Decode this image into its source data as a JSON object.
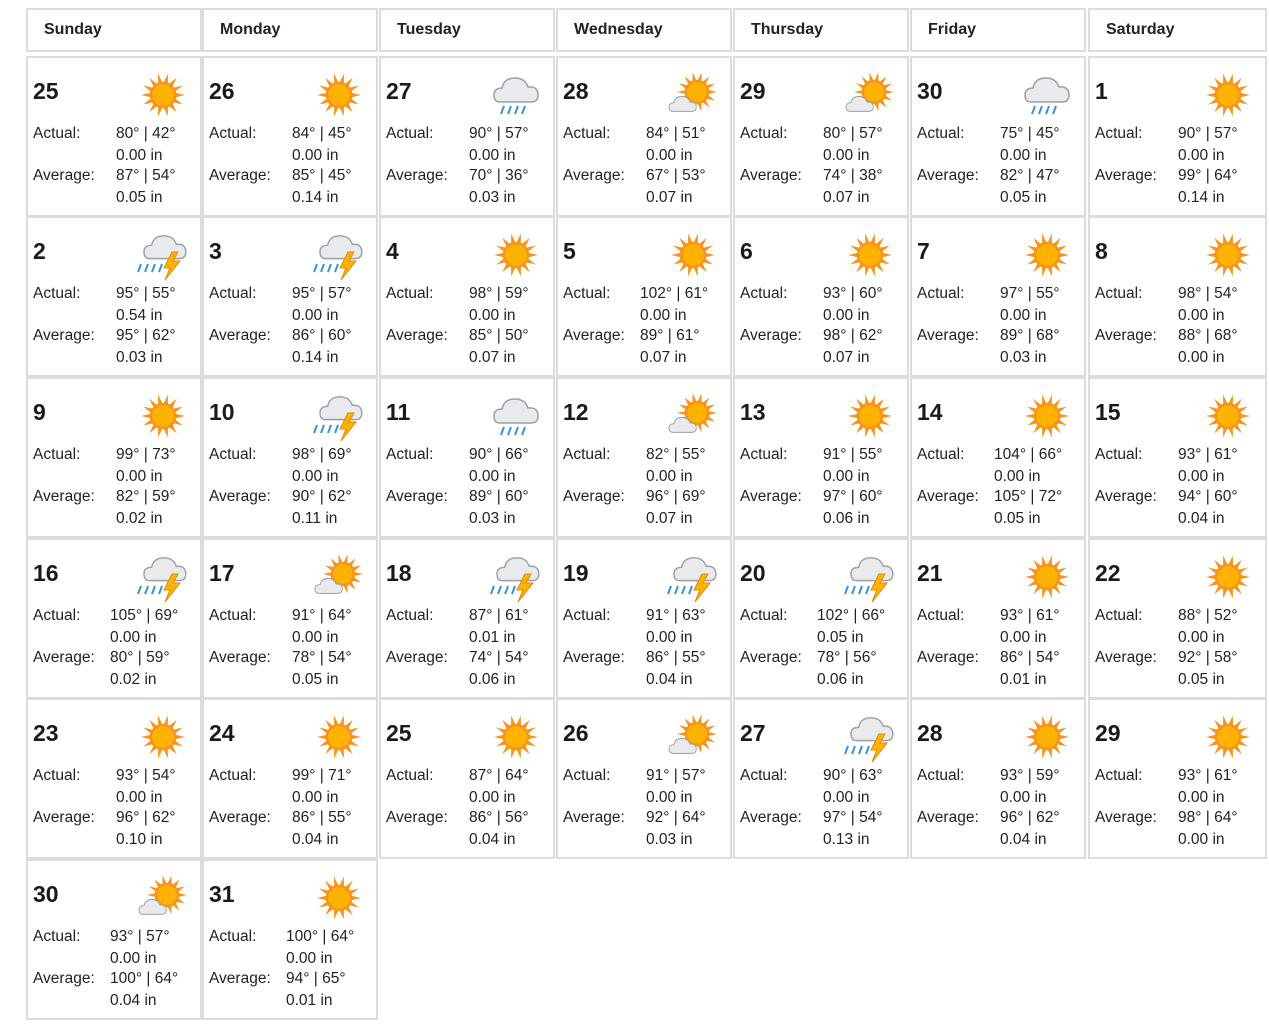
{
  "calendar": {
    "weekdays": [
      "Sunday",
      "Monday",
      "Tuesday",
      "Wednesday",
      "Thursday",
      "Friday",
      "Saturday"
    ],
    "actual_label": "Actual:",
    "average_label": "Average:",
    "colors": {
      "sun": "#f7941d",
      "sun_core": "#ffb300",
      "cloud": "#cfd3d6",
      "rain": "#3b8fd6",
      "bolt": "#ffb300",
      "border": "#dcdcdc"
    },
    "days": [
      {
        "day": "25",
        "icon": "sunny-icon",
        "actual_temp": "80° | 42°",
        "actual_precip": "0.00 in",
        "average_temp": "87° | 54°",
        "average_precip": "0.05 in"
      },
      {
        "day": "26",
        "icon": "sunny-icon",
        "actual_temp": "84° | 45°",
        "actual_precip": "0.00 in",
        "average_temp": "85° | 45°",
        "average_precip": "0.14 in"
      },
      {
        "day": "27",
        "icon": "rain-icon",
        "actual_temp": "90° | 57°",
        "actual_precip": "0.00 in",
        "average_temp": "70° | 36°",
        "average_precip": "0.03 in"
      },
      {
        "day": "28",
        "icon": "partly-cloudy-icon",
        "actual_temp": "84° | 51°",
        "actual_precip": "0.00 in",
        "average_temp": "67° | 53°",
        "average_precip": "0.07 in"
      },
      {
        "day": "29",
        "icon": "partly-cloudy-icon",
        "actual_temp": "80° | 57°",
        "actual_precip": "0.00 in",
        "average_temp": "74° | 38°",
        "average_precip": "0.07 in"
      },
      {
        "day": "30",
        "icon": "rain-icon",
        "actual_temp": "75° | 45°",
        "actual_precip": "0.00 in",
        "average_temp": "82° | 47°",
        "average_precip": "0.05 in"
      },
      {
        "day": "1",
        "icon": "sunny-icon",
        "actual_temp": "90° | 57°",
        "actual_precip": "0.00 in",
        "average_temp": "99° | 64°",
        "average_precip": "0.14 in"
      },
      {
        "day": "2",
        "icon": "thunderstorm-icon",
        "actual_temp": "95° | 55°",
        "actual_precip": "0.54 in",
        "average_temp": "95° | 62°",
        "average_precip": "0.03 in"
      },
      {
        "day": "3",
        "icon": "thunderstorm-icon",
        "actual_temp": "95° | 57°",
        "actual_precip": "0.00 in",
        "average_temp": "86° | 60°",
        "average_precip": "0.14 in"
      },
      {
        "day": "4",
        "icon": "sunny-icon",
        "actual_temp": "98° | 59°",
        "actual_precip": "0.00 in",
        "average_temp": "85° | 50°",
        "average_precip": "0.07 in"
      },
      {
        "day": "5",
        "icon": "sunny-icon",
        "actual_temp": "102° | 61°",
        "actual_precip": "0.00 in",
        "average_temp": "89° | 61°",
        "average_precip": "0.07 in"
      },
      {
        "day": "6",
        "icon": "sunny-icon",
        "actual_temp": "93° | 60°",
        "actual_precip": "0.00 in",
        "average_temp": "98° | 62°",
        "average_precip": "0.07 in"
      },
      {
        "day": "7",
        "icon": "sunny-icon",
        "actual_temp": "97° | 55°",
        "actual_precip": "0.00 in",
        "average_temp": "89° | 68°",
        "average_precip": "0.03 in"
      },
      {
        "day": "8",
        "icon": "sunny-icon",
        "actual_temp": "98° | 54°",
        "actual_precip": "0.00 in",
        "average_temp": "88° | 68°",
        "average_precip": "0.00 in"
      },
      {
        "day": "9",
        "icon": "sunny-icon",
        "actual_temp": "99° | 73°",
        "actual_precip": "0.00 in",
        "average_temp": "82° | 59°",
        "average_precip": "0.02 in"
      },
      {
        "day": "10",
        "icon": "thunderstorm-icon",
        "actual_temp": "98° | 69°",
        "actual_precip": "0.00 in",
        "average_temp": "90° | 62°",
        "average_precip": "0.11 in"
      },
      {
        "day": "11",
        "icon": "rain-icon",
        "actual_temp": "90° | 66°",
        "actual_precip": "0.00 in",
        "average_temp": "89° | 60°",
        "average_precip": "0.03 in"
      },
      {
        "day": "12",
        "icon": "partly-cloudy-icon",
        "actual_temp": "82° | 55°",
        "actual_precip": "0.00 in",
        "average_temp": "96° | 69°",
        "average_precip": "0.07 in"
      },
      {
        "day": "13",
        "icon": "sunny-icon",
        "actual_temp": "91° | 55°",
        "actual_precip": "0.00 in",
        "average_temp": "97° | 60°",
        "average_precip": "0.06 in"
      },
      {
        "day": "14",
        "icon": "sunny-icon",
        "actual_temp": "104° | 66°",
        "actual_precip": "0.00 in",
        "average_temp": "105° | 72°",
        "average_precip": "0.05 in"
      },
      {
        "day": "15",
        "icon": "sunny-icon",
        "actual_temp": "93° | 61°",
        "actual_precip": "0.00 in",
        "average_temp": "94° | 60°",
        "average_precip": "0.04 in"
      },
      {
        "day": "16",
        "icon": "thunderstorm-icon",
        "actual_temp": "105° | 69°",
        "actual_precip": "0.00 in",
        "average_temp": "80° | 59°",
        "average_precip": "0.02 in"
      },
      {
        "day": "17",
        "icon": "partly-cloudy-icon",
        "actual_temp": "91° | 64°",
        "actual_precip": "0.00 in",
        "average_temp": "78° | 54°",
        "average_precip": "0.05 in"
      },
      {
        "day": "18",
        "icon": "thunderstorm-icon",
        "actual_temp": "87° | 61°",
        "actual_precip": "0.01 in",
        "average_temp": "74° | 54°",
        "average_precip": "0.06 in"
      },
      {
        "day": "19",
        "icon": "thunderstorm-icon",
        "actual_temp": "91° | 63°",
        "actual_precip": "0.00 in",
        "average_temp": "86° | 55°",
        "average_precip": "0.04 in"
      },
      {
        "day": "20",
        "icon": "thunderstorm-icon",
        "actual_temp": "102° | 66°",
        "actual_precip": "0.05 in",
        "average_temp": "78° | 56°",
        "average_precip": "0.06 in"
      },
      {
        "day": "21",
        "icon": "sunny-icon",
        "actual_temp": "93° | 61°",
        "actual_precip": "0.00 in",
        "average_temp": "86° | 54°",
        "average_precip": "0.01 in"
      },
      {
        "day": "22",
        "icon": "sunny-icon",
        "actual_temp": "88° | 52°",
        "actual_precip": "0.00 in",
        "average_temp": "92° | 58°",
        "average_precip": "0.05 in"
      },
      {
        "day": "23",
        "icon": "sunny-icon",
        "actual_temp": "93° | 54°",
        "actual_precip": "0.00 in",
        "average_temp": "96° | 62°",
        "average_precip": "0.10 in"
      },
      {
        "day": "24",
        "icon": "sunny-icon",
        "actual_temp": "99° | 71°",
        "actual_precip": "0.00 in",
        "average_temp": "86° | 55°",
        "average_precip": "0.04 in"
      },
      {
        "day": "25",
        "icon": "sunny-icon",
        "actual_temp": "87° | 64°",
        "actual_precip": "0.00 in",
        "average_temp": "86° | 56°",
        "average_precip": "0.04 in"
      },
      {
        "day": "26",
        "icon": "partly-cloudy-icon",
        "actual_temp": "91° | 57°",
        "actual_precip": "0.00 in",
        "average_temp": "92° | 64°",
        "average_precip": "0.03 in"
      },
      {
        "day": "27",
        "icon": "thunderstorm-icon",
        "actual_temp": "90° | 63°",
        "actual_precip": "0.00 in",
        "average_temp": "97° | 54°",
        "average_precip": "0.13 in"
      },
      {
        "day": "28",
        "icon": "sunny-icon",
        "actual_temp": "93° | 59°",
        "actual_precip": "0.00 in",
        "average_temp": "96° | 62°",
        "average_precip": "0.04 in"
      },
      {
        "day": "29",
        "icon": "sunny-icon",
        "actual_temp": "93° | 61°",
        "actual_precip": "0.00 in",
        "average_temp": "98° | 64°",
        "average_precip": "0.00 in"
      },
      {
        "day": "30",
        "icon": "partly-cloudy-icon",
        "actual_temp": "93° | 57°",
        "actual_precip": "0.00 in",
        "average_temp": "100° | 64°",
        "average_precip": "0.04 in"
      },
      {
        "day": "31",
        "icon": "sunny-icon",
        "actual_temp": "100° | 64°",
        "actual_precip": "0.00 in",
        "average_temp": "94° | 65°",
        "average_precip": "0.01 in"
      }
    ]
  }
}
